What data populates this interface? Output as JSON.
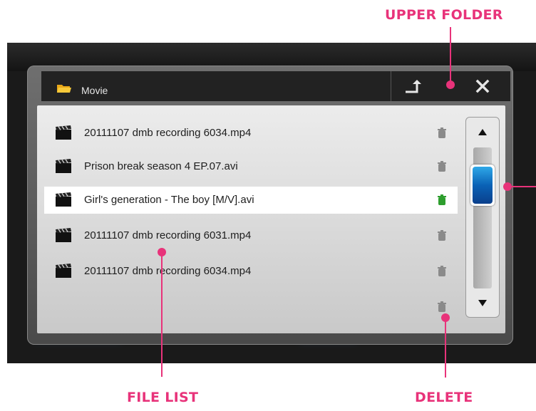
{
  "window": {
    "title": "Movie",
    "folder_icon": "folder-icon",
    "upper_folder_icon": "upper-folder-icon",
    "close_icon": "close-icon"
  },
  "files": [
    {
      "name": "20111107 dmb recording 6034.mp4",
      "selected": false
    },
    {
      "name": "Prison break season 4 EP.07.avi",
      "selected": false
    },
    {
      "name": "Girl's generation - The boy [M/V].avi",
      "selected": true
    },
    {
      "name": "20111107 dmb recording 6031.mp4",
      "selected": false
    },
    {
      "name": "20111107 dmb recording 6034.mp4",
      "selected": false
    }
  ],
  "callouts": {
    "upper_folder": "UPPER FOLDER",
    "file_list": "FILE LIST",
    "delete": "DELETE"
  },
  "colors": {
    "callout": "#e8337a",
    "selected_trash": "#2e9e2e",
    "trash": "#8a8a8a",
    "scroll_thumb": "#0a62b6"
  }
}
